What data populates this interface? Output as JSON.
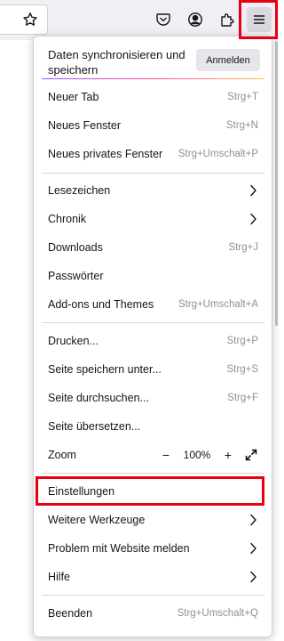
{
  "toolbar": {
    "icons": [
      "star-icon",
      "pocket-icon",
      "account-icon",
      "extensions-icon",
      "hamburger-menu-icon"
    ]
  },
  "menu": {
    "sync_text": "Daten synchronisieren und speichern",
    "signin_label": "Anmelden",
    "new_tab": {
      "label": "Neuer Tab",
      "shortcut": "Strg+T"
    },
    "new_window": {
      "label": "Neues Fenster",
      "shortcut": "Strg+N"
    },
    "private_window": {
      "label": "Neues privates Fenster",
      "shortcut": "Strg+Umschalt+P"
    },
    "bookmarks": {
      "label": "Lesezeichen"
    },
    "history": {
      "label": "Chronik"
    },
    "downloads": {
      "label": "Downloads",
      "shortcut": "Strg+J"
    },
    "passwords": {
      "label": "Passwörter"
    },
    "addons": {
      "label": "Add-ons und Themes",
      "shortcut": "Strg+Umschalt+A"
    },
    "print": {
      "label": "Drucken...",
      "shortcut": "Strg+P"
    },
    "save_page": {
      "label": "Seite speichern unter...",
      "shortcut": "Strg+S"
    },
    "find": {
      "label": "Seite durchsuchen...",
      "shortcut": "Strg+F"
    },
    "translate": {
      "label": "Seite übersetzen..."
    },
    "zoom": {
      "label": "Zoom",
      "minus": "−",
      "value": "100%",
      "plus": "+"
    },
    "settings": {
      "label": "Einstellungen"
    },
    "more_tools": {
      "label": "Weitere Werkzeuge"
    },
    "report": {
      "label": "Problem mit Website melden"
    },
    "help": {
      "label": "Hilfe"
    },
    "quit": {
      "label": "Beenden",
      "shortcut": "Strg+Umschalt+Q"
    }
  },
  "colors": {
    "highlight": "#e60012",
    "accent_gradient": [
      "#9059ff",
      "#ff4aa2",
      "#ffbd4f"
    ]
  }
}
